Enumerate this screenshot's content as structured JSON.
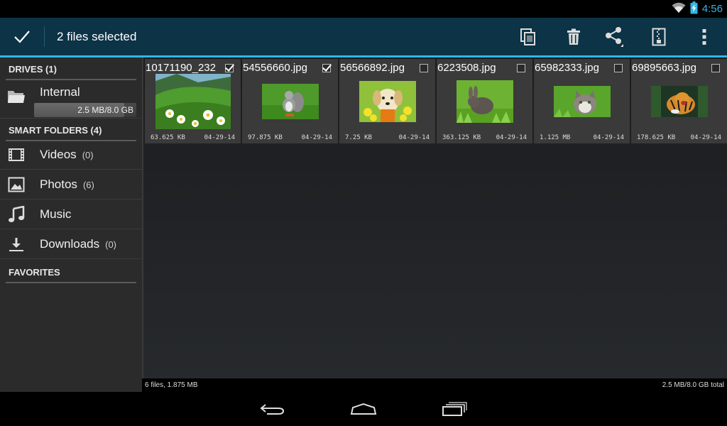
{
  "status_bar": {
    "time": "4:56",
    "icons": [
      "wifi-icon",
      "battery-charging-icon"
    ]
  },
  "action_bar": {
    "title": "2 files selected",
    "actions": [
      "done-check-icon",
      "copy-icon",
      "delete-icon",
      "share-icon",
      "archive-icon",
      "overflow-menu-icon"
    ],
    "accent": "#33b5e5",
    "background": "#0c3346"
  },
  "sidebar": {
    "drives_header": "DRIVES (1)",
    "drive": {
      "label": "Internal",
      "usage": "2.5 MB/8.0 GB",
      "used_fraction": 0.0003
    },
    "smart_header": "SMART FOLDERS (4)",
    "smart_items": [
      {
        "label": "Videos",
        "count": "(0)",
        "icon": "film-icon"
      },
      {
        "label": "Photos",
        "count": "(6)",
        "icon": "image-icon"
      },
      {
        "label": "Music",
        "count": "",
        "icon": "music-note-icon"
      },
      {
        "label": "Downloads",
        "count": "(0)",
        "icon": "download-icon"
      }
    ],
    "favorites_header": "FAVORITES"
  },
  "files": [
    {
      "name": "10171190_232",
      "size": "63.625 KB",
      "date": "04-29-14",
      "checked": true,
      "thumb": "meadow"
    },
    {
      "name": "54556660.jpg",
      "size": "97.875 KB",
      "date": "04-29-14",
      "checked": true,
      "thumb": "squirrel"
    },
    {
      "name": "56566892.jpg",
      "size": "7.25 KB",
      "date": "04-29-14",
      "checked": false,
      "thumb": "puppy"
    },
    {
      "name": "6223508.jpg",
      "size": "363.125 KB",
      "date": "04-29-14",
      "checked": false,
      "thumb": "rabbit"
    },
    {
      "name": "65982333.jpg",
      "size": "1.125 MB",
      "date": "04-29-14",
      "checked": false,
      "thumb": "cat"
    },
    {
      "name": "69895663.jpg",
      "size": "178.625 KB",
      "date": "04-29-14",
      "checked": false,
      "thumb": "tiger"
    }
  ],
  "footer": {
    "left": "6 files, 1.875 MB",
    "right": "2.5 MB/8.0 GB total"
  },
  "nav_bar": [
    "back-icon",
    "home-icon",
    "recent-apps-icon"
  ]
}
